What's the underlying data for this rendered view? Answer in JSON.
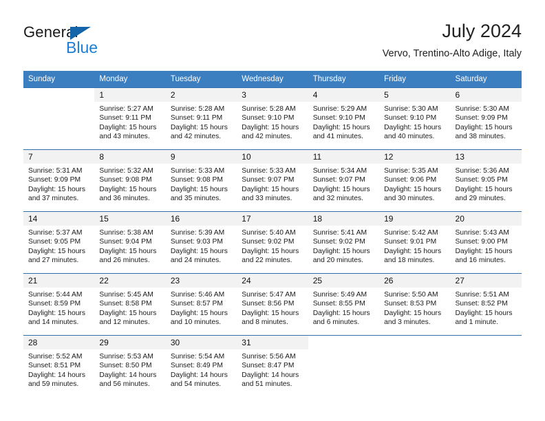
{
  "brand": {
    "name_primary": "General",
    "name_secondary": "Blue",
    "flag_color": "#1464aa",
    "blue_color": "#1a7fd4"
  },
  "header": {
    "title": "July 2024",
    "subtitle": "Vervo, Trentino-Alto Adige, Italy",
    "header_bg": "#3c7fc1",
    "daynum_bg": "#f2f2f2"
  },
  "weekday_headers": [
    "Sunday",
    "Monday",
    "Tuesday",
    "Wednesday",
    "Thursday",
    "Friday",
    "Saturday"
  ],
  "labels": {
    "sunrise": "Sunrise:",
    "sunset": "Sunset:",
    "daylight": "Daylight:"
  },
  "weeks": [
    [
      {
        "day": "",
        "blank": true
      },
      {
        "day": "1",
        "sunrise": "Sunrise: 5:27 AM",
        "sunset": "Sunset: 9:11 PM",
        "daylight_1": "Daylight: 15 hours",
        "daylight_2": "and 43 minutes."
      },
      {
        "day": "2",
        "sunrise": "Sunrise: 5:28 AM",
        "sunset": "Sunset: 9:11 PM",
        "daylight_1": "Daylight: 15 hours",
        "daylight_2": "and 42 minutes."
      },
      {
        "day": "3",
        "sunrise": "Sunrise: 5:28 AM",
        "sunset": "Sunset: 9:10 PM",
        "daylight_1": "Daylight: 15 hours",
        "daylight_2": "and 42 minutes."
      },
      {
        "day": "4",
        "sunrise": "Sunrise: 5:29 AM",
        "sunset": "Sunset: 9:10 PM",
        "daylight_1": "Daylight: 15 hours",
        "daylight_2": "and 41 minutes."
      },
      {
        "day": "5",
        "sunrise": "Sunrise: 5:30 AM",
        "sunset": "Sunset: 9:10 PM",
        "daylight_1": "Daylight: 15 hours",
        "daylight_2": "and 40 minutes."
      },
      {
        "day": "6",
        "sunrise": "Sunrise: 5:30 AM",
        "sunset": "Sunset: 9:09 PM",
        "daylight_1": "Daylight: 15 hours",
        "daylight_2": "and 38 minutes."
      }
    ],
    [
      {
        "day": "7",
        "sunrise": "Sunrise: 5:31 AM",
        "sunset": "Sunset: 9:09 PM",
        "daylight_1": "Daylight: 15 hours",
        "daylight_2": "and 37 minutes."
      },
      {
        "day": "8",
        "sunrise": "Sunrise: 5:32 AM",
        "sunset": "Sunset: 9:08 PM",
        "daylight_1": "Daylight: 15 hours",
        "daylight_2": "and 36 minutes."
      },
      {
        "day": "9",
        "sunrise": "Sunrise: 5:33 AM",
        "sunset": "Sunset: 9:08 PM",
        "daylight_1": "Daylight: 15 hours",
        "daylight_2": "and 35 minutes."
      },
      {
        "day": "10",
        "sunrise": "Sunrise: 5:33 AM",
        "sunset": "Sunset: 9:07 PM",
        "daylight_1": "Daylight: 15 hours",
        "daylight_2": "and 33 minutes."
      },
      {
        "day": "11",
        "sunrise": "Sunrise: 5:34 AM",
        "sunset": "Sunset: 9:07 PM",
        "daylight_1": "Daylight: 15 hours",
        "daylight_2": "and 32 minutes."
      },
      {
        "day": "12",
        "sunrise": "Sunrise: 5:35 AM",
        "sunset": "Sunset: 9:06 PM",
        "daylight_1": "Daylight: 15 hours",
        "daylight_2": "and 30 minutes."
      },
      {
        "day": "13",
        "sunrise": "Sunrise: 5:36 AM",
        "sunset": "Sunset: 9:05 PM",
        "daylight_1": "Daylight: 15 hours",
        "daylight_2": "and 29 minutes."
      }
    ],
    [
      {
        "day": "14",
        "sunrise": "Sunrise: 5:37 AM",
        "sunset": "Sunset: 9:05 PM",
        "daylight_1": "Daylight: 15 hours",
        "daylight_2": "and 27 minutes."
      },
      {
        "day": "15",
        "sunrise": "Sunrise: 5:38 AM",
        "sunset": "Sunset: 9:04 PM",
        "daylight_1": "Daylight: 15 hours",
        "daylight_2": "and 26 minutes."
      },
      {
        "day": "16",
        "sunrise": "Sunrise: 5:39 AM",
        "sunset": "Sunset: 9:03 PM",
        "daylight_1": "Daylight: 15 hours",
        "daylight_2": "and 24 minutes."
      },
      {
        "day": "17",
        "sunrise": "Sunrise: 5:40 AM",
        "sunset": "Sunset: 9:02 PM",
        "daylight_1": "Daylight: 15 hours",
        "daylight_2": "and 22 minutes."
      },
      {
        "day": "18",
        "sunrise": "Sunrise: 5:41 AM",
        "sunset": "Sunset: 9:02 PM",
        "daylight_1": "Daylight: 15 hours",
        "daylight_2": "and 20 minutes."
      },
      {
        "day": "19",
        "sunrise": "Sunrise: 5:42 AM",
        "sunset": "Sunset: 9:01 PM",
        "daylight_1": "Daylight: 15 hours",
        "daylight_2": "and 18 minutes."
      },
      {
        "day": "20",
        "sunrise": "Sunrise: 5:43 AM",
        "sunset": "Sunset: 9:00 PM",
        "daylight_1": "Daylight: 15 hours",
        "daylight_2": "and 16 minutes."
      }
    ],
    [
      {
        "day": "21",
        "sunrise": "Sunrise: 5:44 AM",
        "sunset": "Sunset: 8:59 PM",
        "daylight_1": "Daylight: 15 hours",
        "daylight_2": "and 14 minutes."
      },
      {
        "day": "22",
        "sunrise": "Sunrise: 5:45 AM",
        "sunset": "Sunset: 8:58 PM",
        "daylight_1": "Daylight: 15 hours",
        "daylight_2": "and 12 minutes."
      },
      {
        "day": "23",
        "sunrise": "Sunrise: 5:46 AM",
        "sunset": "Sunset: 8:57 PM",
        "daylight_1": "Daylight: 15 hours",
        "daylight_2": "and 10 minutes."
      },
      {
        "day": "24",
        "sunrise": "Sunrise: 5:47 AM",
        "sunset": "Sunset: 8:56 PM",
        "daylight_1": "Daylight: 15 hours",
        "daylight_2": "and 8 minutes."
      },
      {
        "day": "25",
        "sunrise": "Sunrise: 5:49 AM",
        "sunset": "Sunset: 8:55 PM",
        "daylight_1": "Daylight: 15 hours",
        "daylight_2": "and 6 minutes."
      },
      {
        "day": "26",
        "sunrise": "Sunrise: 5:50 AM",
        "sunset": "Sunset: 8:53 PM",
        "daylight_1": "Daylight: 15 hours",
        "daylight_2": "and 3 minutes."
      },
      {
        "day": "27",
        "sunrise": "Sunrise: 5:51 AM",
        "sunset": "Sunset: 8:52 PM",
        "daylight_1": "Daylight: 15 hours",
        "daylight_2": "and 1 minute."
      }
    ],
    [
      {
        "day": "28",
        "sunrise": "Sunrise: 5:52 AM",
        "sunset": "Sunset: 8:51 PM",
        "daylight_1": "Daylight: 14 hours",
        "daylight_2": "and 59 minutes."
      },
      {
        "day": "29",
        "sunrise": "Sunrise: 5:53 AM",
        "sunset": "Sunset: 8:50 PM",
        "daylight_1": "Daylight: 14 hours",
        "daylight_2": "and 56 minutes."
      },
      {
        "day": "30",
        "sunrise": "Sunrise: 5:54 AM",
        "sunset": "Sunset: 8:49 PM",
        "daylight_1": "Daylight: 14 hours",
        "daylight_2": "and 54 minutes."
      },
      {
        "day": "31",
        "sunrise": "Sunrise: 5:56 AM",
        "sunset": "Sunset: 8:47 PM",
        "daylight_1": "Daylight: 14 hours",
        "daylight_2": "and 51 minutes."
      },
      {
        "day": "",
        "blank": true
      },
      {
        "day": "",
        "blank": true
      },
      {
        "day": "",
        "blank": true
      }
    ]
  ]
}
